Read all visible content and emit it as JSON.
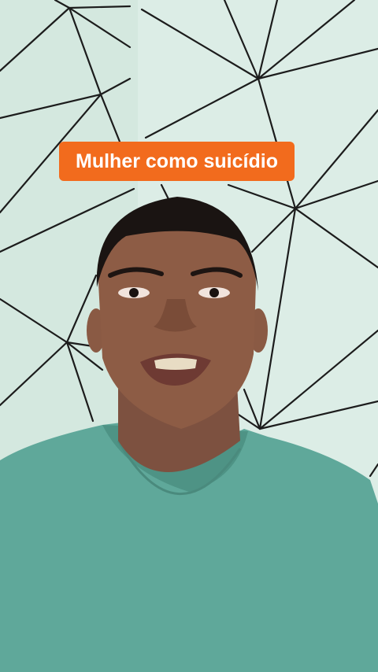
{
  "caption": {
    "text": "Mulher como suicídio",
    "background": "#f26b1d",
    "color": "#ffffff"
  },
  "scene": {
    "wall_color": "#d4e8df",
    "line_color": "#1c1c1c",
    "shirt_color": "#5fa89a",
    "skin_color": "#8a5a44"
  }
}
